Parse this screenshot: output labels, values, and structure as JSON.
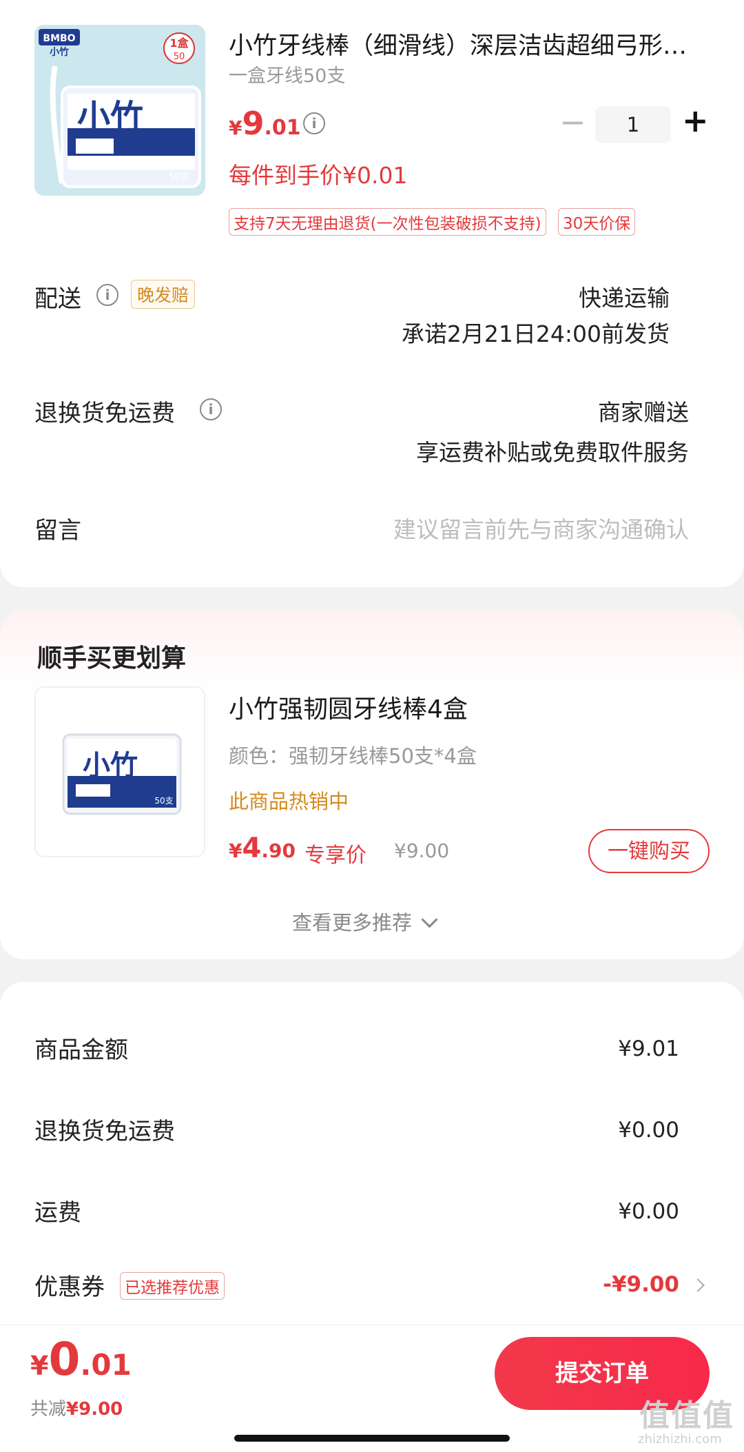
{
  "product": {
    "title": "小竹牙线棒（细滑线）深层洁齿超细弓形…",
    "spec": "一盒牙线50支",
    "price_symbol": "¥",
    "price_int": "9",
    "price_dec": ".01",
    "final_price": "每件到手价¥0.01",
    "quantity": "1",
    "qty_minus": "−",
    "qty_plus": "+",
    "tags": [
      "支持7天无理由退货(一次性包装破损不支持)",
      "30天价保"
    ],
    "image": {
      "brand": "BMBO",
      "name": "小竹",
      "badge_top": "1盒",
      "badge_bottom": "50",
      "count": "50支"
    }
  },
  "delivery": {
    "label": "配送",
    "tag": "晚发赔",
    "method": "快递运输",
    "promise": "承诺2月21日24:00前发货"
  },
  "return_shipping": {
    "label": "退换货免运费",
    "value_line1": "商家赠送",
    "value_line2": "享运费补贴或免费取件服务"
  },
  "message": {
    "label": "留言",
    "placeholder": "建议留言前先与商家沟通确认"
  },
  "upsell": {
    "heading": "顺手买更划算",
    "title": "小竹强韧圆牙线棒4盒",
    "spec": "颜色：强韧牙线棒50支*4盒",
    "status": "此商品热销中",
    "price_symbol": "¥",
    "price_int": "4",
    "price_dec": ".90",
    "price_label": "专享价",
    "original_price": "¥9.00",
    "buy_button": "一键购买",
    "image": {
      "name": "小竹",
      "count": "50支"
    },
    "more": "查看更多推荐"
  },
  "summary": {
    "items": [
      {
        "label": "商品金额",
        "value": "¥9.01"
      },
      {
        "label": "退换货免运费",
        "value": "¥0.00"
      },
      {
        "label": "运费",
        "value": "¥0.00"
      }
    ],
    "coupon_label": "优惠券",
    "coupon_tag": "已选推荐优惠",
    "coupon_value": "-¥9.00"
  },
  "footer": {
    "total_symbol": "¥",
    "total_int": "0",
    "total_dec": ".01",
    "saved_label": "共减",
    "saved_value": "¥9.00",
    "submit": "提交订单"
  },
  "watermark": {
    "main": "值值值",
    "sub": "zhizhizhi.com"
  },
  "colors": {
    "accent": "#e4393c",
    "gold": "#d48a1e",
    "submit": "#f2394a"
  },
  "icons": [
    "info-icon",
    "chevron-right-icon",
    "chevron-down-icon",
    "minus-icon",
    "plus-icon"
  ]
}
